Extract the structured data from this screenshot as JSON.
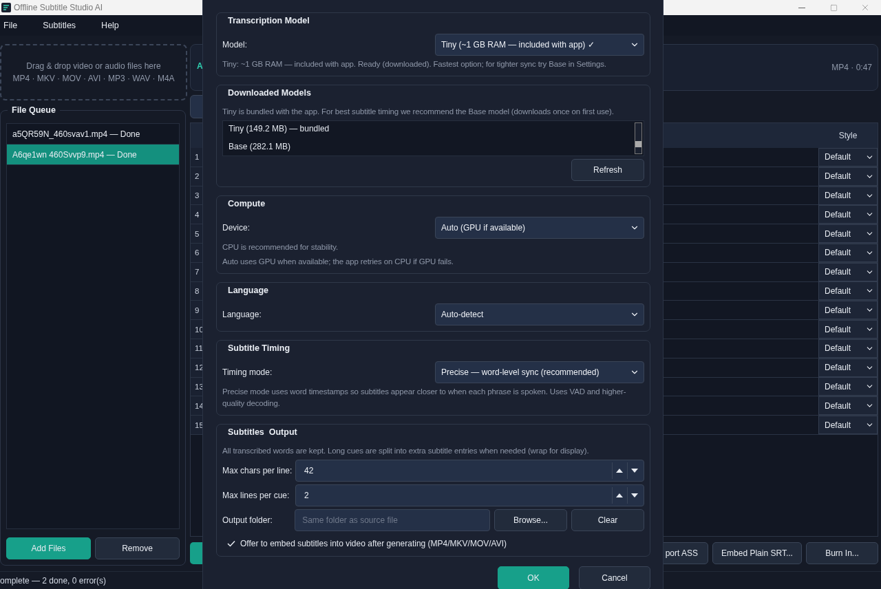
{
  "window": {
    "title": "Offline Subtitle Studio AI"
  },
  "menu": [
    "File",
    "Subtitles",
    "Help"
  ],
  "drop_zone": {
    "lines": [
      "Drag & drop video or audio files here",
      "MP4 · MKV · MOV · AVI · MP3 · WAV · M4A"
    ]
  },
  "file_queue": {
    "title": "File Queue",
    "items": [
      {
        "label": "a5QR59N_460svav1.mp4 — Done",
        "selected": false
      },
      {
        "label": "A6qe1wn 460Svvp9.mp4 — Done",
        "selected": true
      }
    ],
    "buttons": [
      "Add Files",
      "Remove"
    ]
  },
  "media_card": {
    "title": "A",
    "info": "MP4 · 0:47"
  },
  "table": {
    "style_column": "Style",
    "rows": [
      {
        "number": "1",
        "style": "Default"
      },
      {
        "number": "2",
        "style": "Default"
      },
      {
        "number": "3",
        "style": "Default"
      },
      {
        "number": "4",
        "style": "Default"
      },
      {
        "number": "5",
        "style": "Default"
      },
      {
        "number": "6",
        "style": "Default"
      },
      {
        "number": "7",
        "style": "Default"
      },
      {
        "number": "8",
        "style": "Default"
      },
      {
        "number": "9",
        "style": "Default"
      },
      {
        "number": "10",
        "style": "Default"
      },
      {
        "number": "11",
        "style": "Default"
      },
      {
        "number": "12",
        "style": "Default"
      },
      {
        "number": "13",
        "style": "Default"
      },
      {
        "number": "14",
        "style": "Default"
      },
      {
        "number": "15",
        "style": "Default"
      }
    ]
  },
  "actions": [
    "port ASS",
    "Embed Plain SRT...",
    "Burn In..."
  ],
  "status_bar": "omplete — 2 done, 0 error(s)",
  "dialog": {
    "groups": [
      {
        "title": "Transcription Model",
        "items": [
          {
            "kind": "select",
            "label": "Model:",
            "value": "Tiny (~1 GB RAM — included with app) ✓"
          },
          {
            "kind": "note",
            "text": "Tiny: ~1 GB RAM — included with app. Ready (downloaded). Fastest option; for tighter sync try Base in Settings."
          }
        ]
      },
      {
        "title": "Downloaded Models",
        "items": [
          {
            "kind": "note",
            "text": "Tiny is bundled with the app. For best subtitle timing we recommend the Base model (downloads once on first use)."
          },
          {
            "kind": "list",
            "entries": [
              "Tiny (149.2 MB) — bundled",
              "Base (282.1 MB)"
            ]
          },
          {
            "kind": "button",
            "label": "Refresh"
          }
        ]
      },
      {
        "title": "Compute",
        "items": [
          {
            "kind": "select",
            "label": "Device:",
            "value": "Auto (GPU if available)"
          },
          {
            "kind": "note",
            "text": "CPU is recommended for stability."
          },
          {
            "kind": "note",
            "text": "Auto uses GPU when available; the app retries on CPU if GPU fails."
          }
        ]
      },
      {
        "title": "Language",
        "items": [
          {
            "kind": "select",
            "label": "Language:",
            "value": "Auto-detect"
          }
        ]
      },
      {
        "title": "Subtitle Timing",
        "items": [
          {
            "kind": "select",
            "label": "Timing mode:",
            "value": "Precise — word-level sync (recommended)"
          },
          {
            "kind": "note",
            "text": "Precise mode uses word timestamps so subtitles appear closer to when each phrase is spoken. Uses VAD and higher-quality decoding."
          }
        ]
      },
      {
        "title": "Subtitles  Output",
        "items": [
          {
            "kind": "note",
            "text": "All transcribed words are kept. Long cues are split into extra subtitle entries when needed (wrap for display)."
          },
          {
            "kind": "spin",
            "label": "Max chars per line:",
            "value": "42"
          },
          {
            "kind": "spin",
            "label": "Max lines per cue:",
            "value": "2"
          },
          {
            "kind": "folder",
            "label": "Output folder:",
            "placeholder": "Same folder as source file",
            "buttons": [
              "Browse...",
              "Clear"
            ]
          },
          {
            "kind": "checkbox",
            "label": "Offer to embed subtitles into video after generating (MP4/MKV/MOV/AVI)",
            "checked": true
          }
        ]
      }
    ],
    "buttons": [
      "OK",
      "Cancel"
    ]
  }
}
